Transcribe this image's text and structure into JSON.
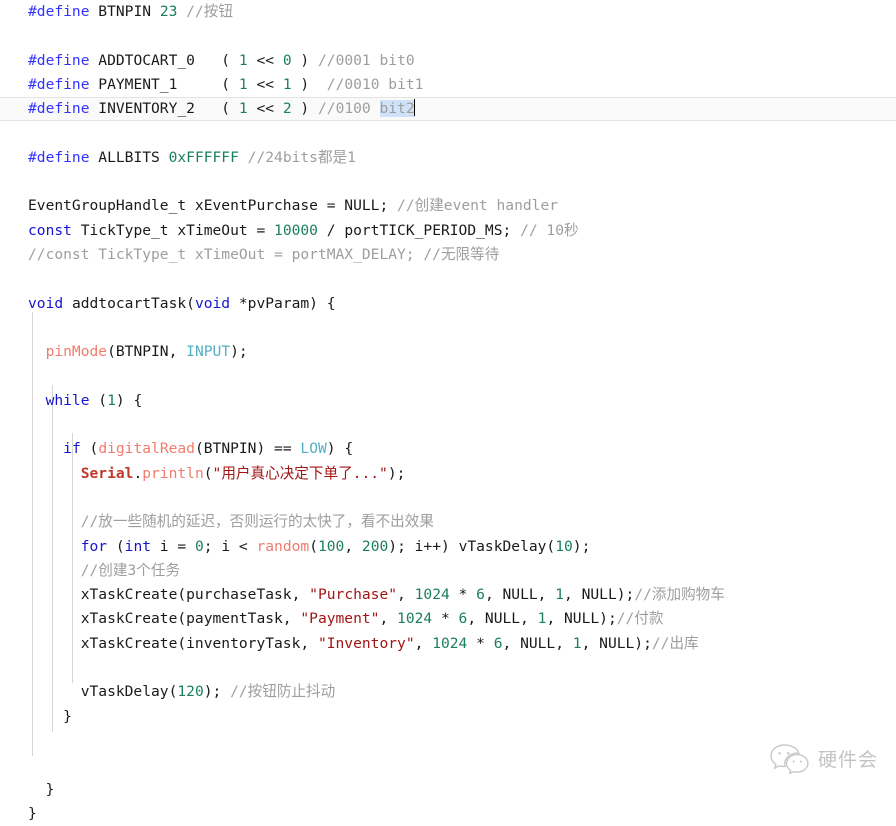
{
  "editor": {
    "language": "cpp",
    "cursor_line_index": 4,
    "selection_text": "bit2",
    "colors": {
      "background": "#ffffff",
      "foreground": "#1a1a1a",
      "preprocessor": "#3333ff",
      "keyword": "#1515d0",
      "number": "#1a7f5a",
      "comment": "#9e9e9e",
      "string": "#a31515",
      "builtin_function": "#f07c6e",
      "class_name": "#c0392b",
      "constant": "#52b0c0",
      "selection": "#cfe2f7",
      "current_line": "#fafafa",
      "indent_guide": "#d6d6d6"
    },
    "lines": [
      {
        "indent": 0,
        "tokens": [
          {
            "t": "#define",
            "c": "pre"
          },
          {
            "t": " BTNPIN ",
            "c": "plain"
          },
          {
            "t": "23",
            "c": "num"
          },
          {
            "t": " //按钮",
            "c": "cmt"
          }
        ]
      },
      {
        "indent": 0,
        "tokens": []
      },
      {
        "indent": 0,
        "tokens": [
          {
            "t": "#define",
            "c": "pre"
          },
          {
            "t": " ADDTOCART_0   ( ",
            "c": "plain"
          },
          {
            "t": "1",
            "c": "num"
          },
          {
            "t": " << ",
            "c": "plain"
          },
          {
            "t": "0",
            "c": "num"
          },
          {
            "t": " ) ",
            "c": "plain"
          },
          {
            "t": "//0001 bit0",
            "c": "cmt"
          }
        ]
      },
      {
        "indent": 0,
        "tokens": [
          {
            "t": "#define",
            "c": "pre"
          },
          {
            "t": " PAYMENT_1     ( ",
            "c": "plain"
          },
          {
            "t": "1",
            "c": "num"
          },
          {
            "t": " << ",
            "c": "plain"
          },
          {
            "t": "1",
            "c": "num"
          },
          {
            "t": " )  ",
            "c": "plain"
          },
          {
            "t": "//0010 bit1",
            "c": "cmt"
          }
        ]
      },
      {
        "indent": 0,
        "current": true,
        "tokens": [
          {
            "t": "#define",
            "c": "pre"
          },
          {
            "t": " INVENTORY_2   ( ",
            "c": "plain"
          },
          {
            "t": "1",
            "c": "num"
          },
          {
            "t": " << ",
            "c": "plain"
          },
          {
            "t": "2",
            "c": "num"
          },
          {
            "t": " ) ",
            "c": "plain"
          },
          {
            "t": "//0100 ",
            "c": "cmt"
          },
          {
            "t": "bit2",
            "c": "cmt",
            "sel": true
          },
          {
            "t": "",
            "c": "plain",
            "caret": true
          }
        ]
      },
      {
        "indent": 0,
        "tokens": []
      },
      {
        "indent": 0,
        "tokens": [
          {
            "t": "#define",
            "c": "pre"
          },
          {
            "t": " ALLBITS ",
            "c": "plain"
          },
          {
            "t": "0xFFFFFF",
            "c": "num"
          },
          {
            "t": " //24bits都是1",
            "c": "cmt"
          }
        ]
      },
      {
        "indent": 0,
        "tokens": []
      },
      {
        "indent": 0,
        "tokens": [
          {
            "t": "EventGroupHandle_t xEventPurchase = NULL; ",
            "c": "plain"
          },
          {
            "t": "//创建event handler",
            "c": "cmt"
          }
        ]
      },
      {
        "indent": 0,
        "tokens": [
          {
            "t": "const",
            "c": "kw"
          },
          {
            "t": " TickType_t xTimeOut = ",
            "c": "plain"
          },
          {
            "t": "10000",
            "c": "num"
          },
          {
            "t": " / portTICK_PERIOD_MS; ",
            "c": "plain"
          },
          {
            "t": "// 10秒",
            "c": "cmt"
          }
        ]
      },
      {
        "indent": 0,
        "tokens": [
          {
            "t": "//const TickType_t xTimeOut = portMAX_DELAY; //无限等待",
            "c": "cmt"
          }
        ]
      },
      {
        "indent": 0,
        "tokens": []
      },
      {
        "indent": 0,
        "tokens": [
          {
            "t": "void",
            "c": "kw"
          },
          {
            "t": " addtocartTask(",
            "c": "plain"
          },
          {
            "t": "void",
            "c": "kw"
          },
          {
            "t": " *pvParam) {",
            "c": "plain"
          }
        ]
      },
      {
        "indent": 1,
        "tokens": []
      },
      {
        "indent": 1,
        "tokens": [
          {
            "t": "  ",
            "c": "plain"
          },
          {
            "t": "pinMode",
            "c": "fn"
          },
          {
            "t": "(BTNPIN, ",
            "c": "plain"
          },
          {
            "t": "INPUT",
            "c": "const"
          },
          {
            "t": ");",
            "c": "plain"
          }
        ]
      },
      {
        "indent": 1,
        "tokens": []
      },
      {
        "indent": 1,
        "tokens": [
          {
            "t": "  ",
            "c": "plain"
          },
          {
            "t": "while",
            "c": "kw"
          },
          {
            "t": " (",
            "c": "plain"
          },
          {
            "t": "1",
            "c": "num"
          },
          {
            "t": ") {",
            "c": "plain"
          }
        ]
      },
      {
        "indent": 2,
        "tokens": []
      },
      {
        "indent": 2,
        "tokens": [
          {
            "t": "    ",
            "c": "plain"
          },
          {
            "t": "if",
            "c": "kw"
          },
          {
            "t": " (",
            "c": "plain"
          },
          {
            "t": "digitalRead",
            "c": "fn"
          },
          {
            "t": "(BTNPIN) == ",
            "c": "plain"
          },
          {
            "t": "LOW",
            "c": "const"
          },
          {
            "t": ") {",
            "c": "plain"
          }
        ]
      },
      {
        "indent": 3,
        "tokens": [
          {
            "t": "      ",
            "c": "plain"
          },
          {
            "t": "Serial",
            "c": "cls"
          },
          {
            "t": ".",
            "c": "plain"
          },
          {
            "t": "println",
            "c": "fn"
          },
          {
            "t": "(",
            "c": "plain"
          },
          {
            "t": "\"用户真心决定下单了...\"",
            "c": "str"
          },
          {
            "t": ");",
            "c": "plain"
          }
        ]
      },
      {
        "indent": 3,
        "tokens": []
      },
      {
        "indent": 3,
        "tokens": [
          {
            "t": "      ",
            "c": "plain"
          },
          {
            "t": "//放一些随机的延迟，否则运行的太快了，看不出效果",
            "c": "cmt"
          }
        ]
      },
      {
        "indent": 3,
        "tokens": [
          {
            "t": "      ",
            "c": "plain"
          },
          {
            "t": "for",
            "c": "kw"
          },
          {
            "t": " (",
            "c": "plain"
          },
          {
            "t": "int",
            "c": "kw"
          },
          {
            "t": " i = ",
            "c": "plain"
          },
          {
            "t": "0",
            "c": "num"
          },
          {
            "t": "; i < ",
            "c": "plain"
          },
          {
            "t": "random",
            "c": "fn"
          },
          {
            "t": "(",
            "c": "plain"
          },
          {
            "t": "100",
            "c": "num"
          },
          {
            "t": ", ",
            "c": "plain"
          },
          {
            "t": "200",
            "c": "num"
          },
          {
            "t": "); i++) vTaskDelay(",
            "c": "plain"
          },
          {
            "t": "10",
            "c": "num"
          },
          {
            "t": ");",
            "c": "plain"
          }
        ]
      },
      {
        "indent": 3,
        "tokens": [
          {
            "t": "      ",
            "c": "plain"
          },
          {
            "t": "//创建3个任务",
            "c": "cmt"
          }
        ]
      },
      {
        "indent": 3,
        "tokens": [
          {
            "t": "      xTaskCreate(purchaseTask, ",
            "c": "plain"
          },
          {
            "t": "\"Purchase\"",
            "c": "str"
          },
          {
            "t": ", ",
            "c": "plain"
          },
          {
            "t": "1024",
            "c": "num"
          },
          {
            "t": " * ",
            "c": "plain"
          },
          {
            "t": "6",
            "c": "num"
          },
          {
            "t": ", NULL, ",
            "c": "plain"
          },
          {
            "t": "1",
            "c": "num"
          },
          {
            "t": ", NULL);",
            "c": "plain"
          },
          {
            "t": "//添加购物车",
            "c": "cmt"
          }
        ]
      },
      {
        "indent": 3,
        "tokens": [
          {
            "t": "      xTaskCreate(paymentTask, ",
            "c": "plain"
          },
          {
            "t": "\"Payment\"",
            "c": "str"
          },
          {
            "t": ", ",
            "c": "plain"
          },
          {
            "t": "1024",
            "c": "num"
          },
          {
            "t": " * ",
            "c": "plain"
          },
          {
            "t": "6",
            "c": "num"
          },
          {
            "t": ", NULL, ",
            "c": "plain"
          },
          {
            "t": "1",
            "c": "num"
          },
          {
            "t": ", NULL);",
            "c": "plain"
          },
          {
            "t": "//付款",
            "c": "cmt"
          }
        ]
      },
      {
        "indent": 3,
        "tokens": [
          {
            "t": "      xTaskCreate(inventoryTask, ",
            "c": "plain"
          },
          {
            "t": "\"Inventory\"",
            "c": "str"
          },
          {
            "t": ", ",
            "c": "plain"
          },
          {
            "t": "1024",
            "c": "num"
          },
          {
            "t": " * ",
            "c": "plain"
          },
          {
            "t": "6",
            "c": "num"
          },
          {
            "t": ", NULL, ",
            "c": "plain"
          },
          {
            "t": "1",
            "c": "num"
          },
          {
            "t": ", NULL);",
            "c": "plain"
          },
          {
            "t": "//出库",
            "c": "cmt"
          }
        ]
      },
      {
        "indent": 3,
        "tokens": []
      },
      {
        "indent": 3,
        "tokens": [
          {
            "t": "      vTaskDelay(",
            "c": "plain"
          },
          {
            "t": "120",
            "c": "num"
          },
          {
            "t": "); ",
            "c": "plain"
          },
          {
            "t": "//按钮防止抖动",
            "c": "cmt"
          }
        ]
      },
      {
        "indent": 2,
        "tokens": [
          {
            "t": "    }",
            "c": "plain"
          }
        ]
      },
      {
        "indent": 2,
        "tokens": []
      },
      {
        "indent": 2,
        "tokens": []
      },
      {
        "indent": 1,
        "tokens": [
          {
            "t": "  }",
            "c": "plain"
          }
        ]
      },
      {
        "indent": 0,
        "tokens": [
          {
            "t": "}",
            "c": "plain"
          }
        ]
      }
    ]
  },
  "watermark": {
    "icon": "wechat-icon",
    "label": "硬件会"
  }
}
